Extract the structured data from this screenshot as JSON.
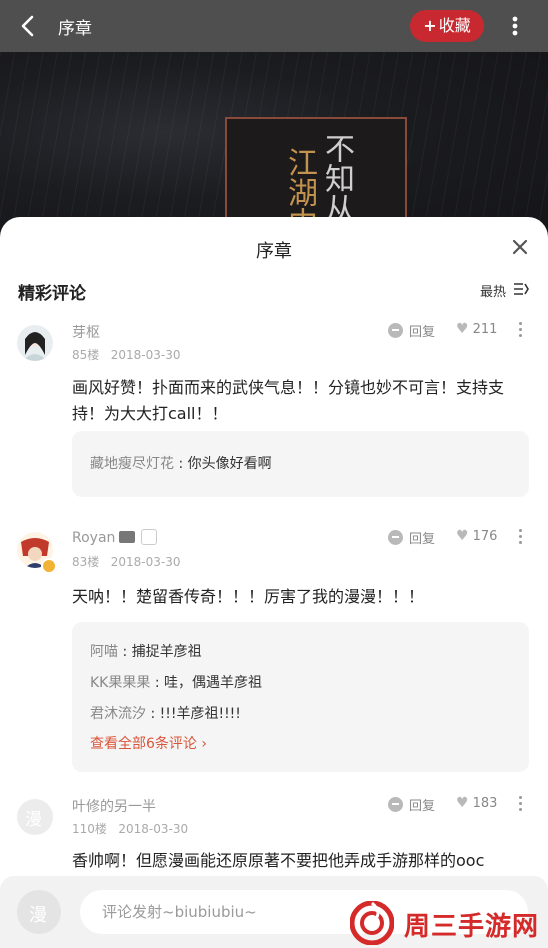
{
  "topbar": {
    "title": "序章",
    "favorite_label": "收藏",
    "favorite_plus": "+"
  },
  "cover": {
    "col1": "江湖中",
    "col2": "不知从"
  },
  "sheet": {
    "title": "序章",
    "section": "精彩评论",
    "sort_label": "最热"
  },
  "comments": [
    {
      "user": "芽枢",
      "floor": "85楼",
      "date": "2018-03-30",
      "reply_label": "回复",
      "likes": "211",
      "text": "画风好赞！扑面而来的武侠气息！！分镜也妙不可言！支持支持！为大大打call！！",
      "replies": [
        {
          "name": "藏地瘦尽灯花",
          "sep": " : ",
          "text": "你头像好看啊"
        }
      ]
    },
    {
      "user": "Royan",
      "floor": "83楼",
      "date": "2018-03-30",
      "reply_label": "回复",
      "likes": "176",
      "text": "天呐！！楚留香传奇！！！厉害了我的漫漫！！！",
      "replies": [
        {
          "name": "阿喵",
          "sep": " : ",
          "text": "捕捉羊彦祖"
        },
        {
          "name": "KK果果果",
          "sep": " : ",
          "text": "哇，偶遇羊彦祖"
        },
        {
          "name": "君沐流汐",
          "sep": " : ",
          "text": "!!!羊彦祖!!!!"
        }
      ],
      "view_all": "查看全部6条评论 ›"
    },
    {
      "user": "叶修的另一半",
      "floor": "110楼",
      "date": "2018-03-30",
      "reply_label": "回复",
      "likes": "183",
      "text": "香帅啊！但愿漫画能还原原著不要把他弄成手游那样的ooc"
    }
  ],
  "bottom": {
    "placeholder": "评论发射~biubiubiu~"
  },
  "watermark": {
    "text": "周三手游网"
  },
  "colors": {
    "accent": "#c8282f",
    "link": "#d9553a"
  }
}
